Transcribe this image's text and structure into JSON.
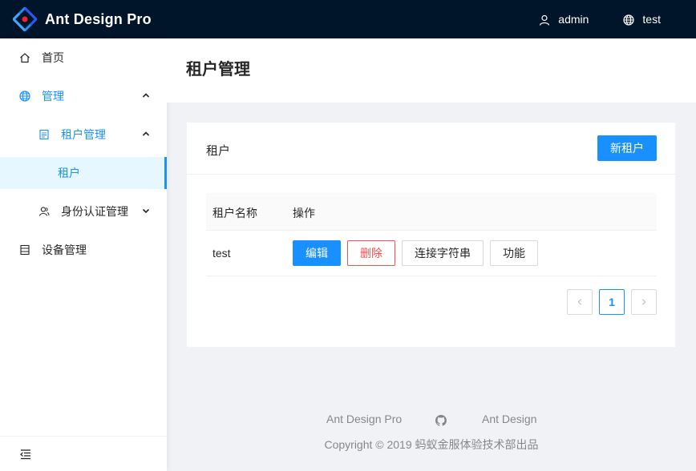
{
  "header": {
    "app_title": "Ant Design Pro",
    "user_name": "admin",
    "language": "test"
  },
  "sidebar": {
    "items": [
      {
        "label": "首页",
        "icon": "home-icon"
      },
      {
        "label": "管理",
        "icon": "global-icon",
        "expanded": true
      },
      {
        "label": "租户管理",
        "icon": "profile-icon",
        "expanded": true
      },
      {
        "label": "租户",
        "selected": true
      },
      {
        "label": "身份认证管理",
        "icon": "team-icon",
        "expanded": false
      },
      {
        "label": "设备管理",
        "icon": "container-icon"
      }
    ]
  },
  "page": {
    "title": "租户管理"
  },
  "card": {
    "title": "租户",
    "new_button": "新租户"
  },
  "table": {
    "columns": [
      "租户名称",
      "操作"
    ],
    "rows": [
      {
        "name": "test",
        "actions": [
          "编辑",
          "删除",
          "连接字符串",
          "功能"
        ]
      }
    ]
  },
  "pagination": {
    "current_page": "1",
    "prev": "‹",
    "next": "›"
  },
  "footer": {
    "link1": "Ant Design Pro",
    "link2": "Ant Design",
    "copyright": "Copyright © 2019 蚂蚁金服体验技术部出品"
  },
  "colors": {
    "primary": "#1890ff",
    "header_bg": "#001529",
    "danger": "#ff4d4f"
  }
}
